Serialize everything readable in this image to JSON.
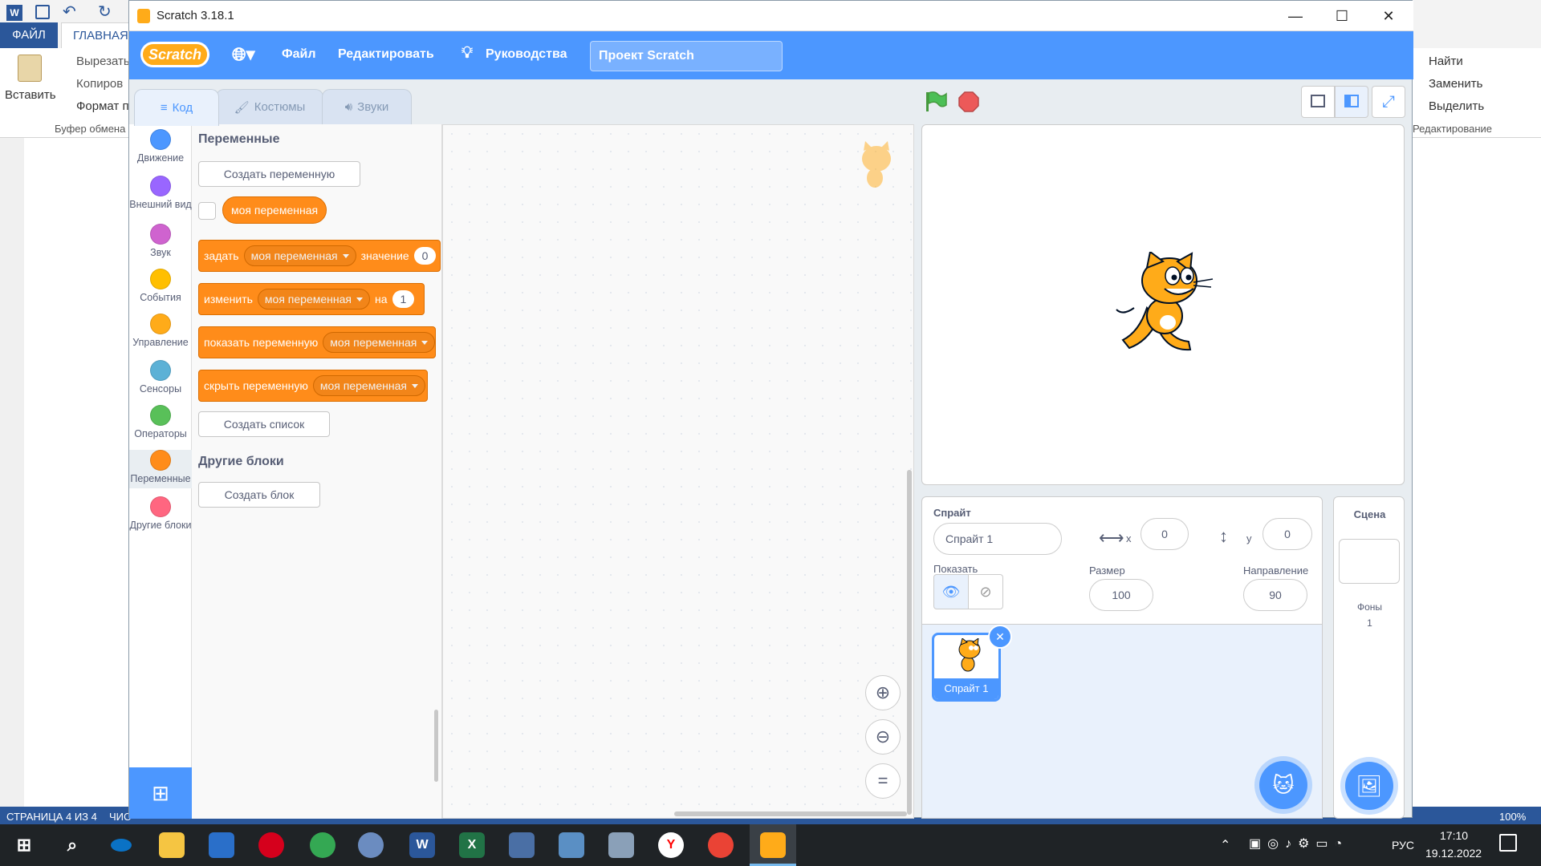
{
  "window": {
    "title": "Scratch 3.18.1"
  },
  "word": {
    "tab_file": "ФАЙЛ",
    "tab_home": "ГЛАВНАЯ",
    "paste": "Вставить",
    "cut": "Вырезать",
    "copy": "Копиров",
    "format": "Формат п",
    "clipboard": "Буфер обмена",
    "find": "Найти",
    "replace": "Заменить",
    "select": "Выделить",
    "editing": "Редактирование",
    "status_page": "СТРАНИЦА 4 ИЗ 4",
    "status_words": "ЧИС",
    "zoom": "100%"
  },
  "menu": {
    "file": "Файл",
    "edit": "Редактировать",
    "tutorials": "Руководства",
    "project_title": "Проект Scratch",
    "logo": "Scratch"
  },
  "tabs": {
    "code": "Код",
    "costumes": "Костюмы",
    "sounds": "Звуки"
  },
  "categories": [
    {
      "label": "Движение",
      "color": "#4c97ff"
    },
    {
      "label": "Внешний вид",
      "color": "#9966ff"
    },
    {
      "label": "Звук",
      "color": "#cf63cf"
    },
    {
      "label": "События",
      "color": "#ffbf00"
    },
    {
      "label": "Управление",
      "color": "#ffab19"
    },
    {
      "label": "Сенсоры",
      "color": "#5cb1d6"
    },
    {
      "label": "Операторы",
      "color": "#59c059"
    },
    {
      "label": "Переменные",
      "color": "#ff8c1a"
    },
    {
      "label": "Другие блоки",
      "color": "#ff6680"
    }
  ],
  "palette": {
    "variables_heading": "Переменные",
    "make_variable": "Создать переменную",
    "variable_name": "моя переменная",
    "set_label": "задать",
    "set_value_label": "значение",
    "set_value": "0",
    "change_label": "изменить",
    "change_by_label": "на",
    "change_value": "1",
    "show_label": "показать переменную",
    "hide_label": "скрыть переменную",
    "make_list": "Создать список",
    "other_heading": "Другие блоки",
    "make_block": "Создать блок"
  },
  "sprite": {
    "label": "Спрайт",
    "name": "Спрайт 1",
    "x_label": "x",
    "x": "0",
    "y_label": "y",
    "y": "0",
    "show_label": "Показать",
    "size_label": "Размер",
    "size": "100",
    "direction_label": "Направление",
    "direction": "90",
    "thumb_name": "Спрайт 1"
  },
  "stage_panel": {
    "title": "Сцена",
    "backdrops_label": "Фоны",
    "backdrops_count": "1"
  },
  "taskbar": {
    "lang": "РУС",
    "time": "17:10",
    "date": "19.12.2022"
  }
}
